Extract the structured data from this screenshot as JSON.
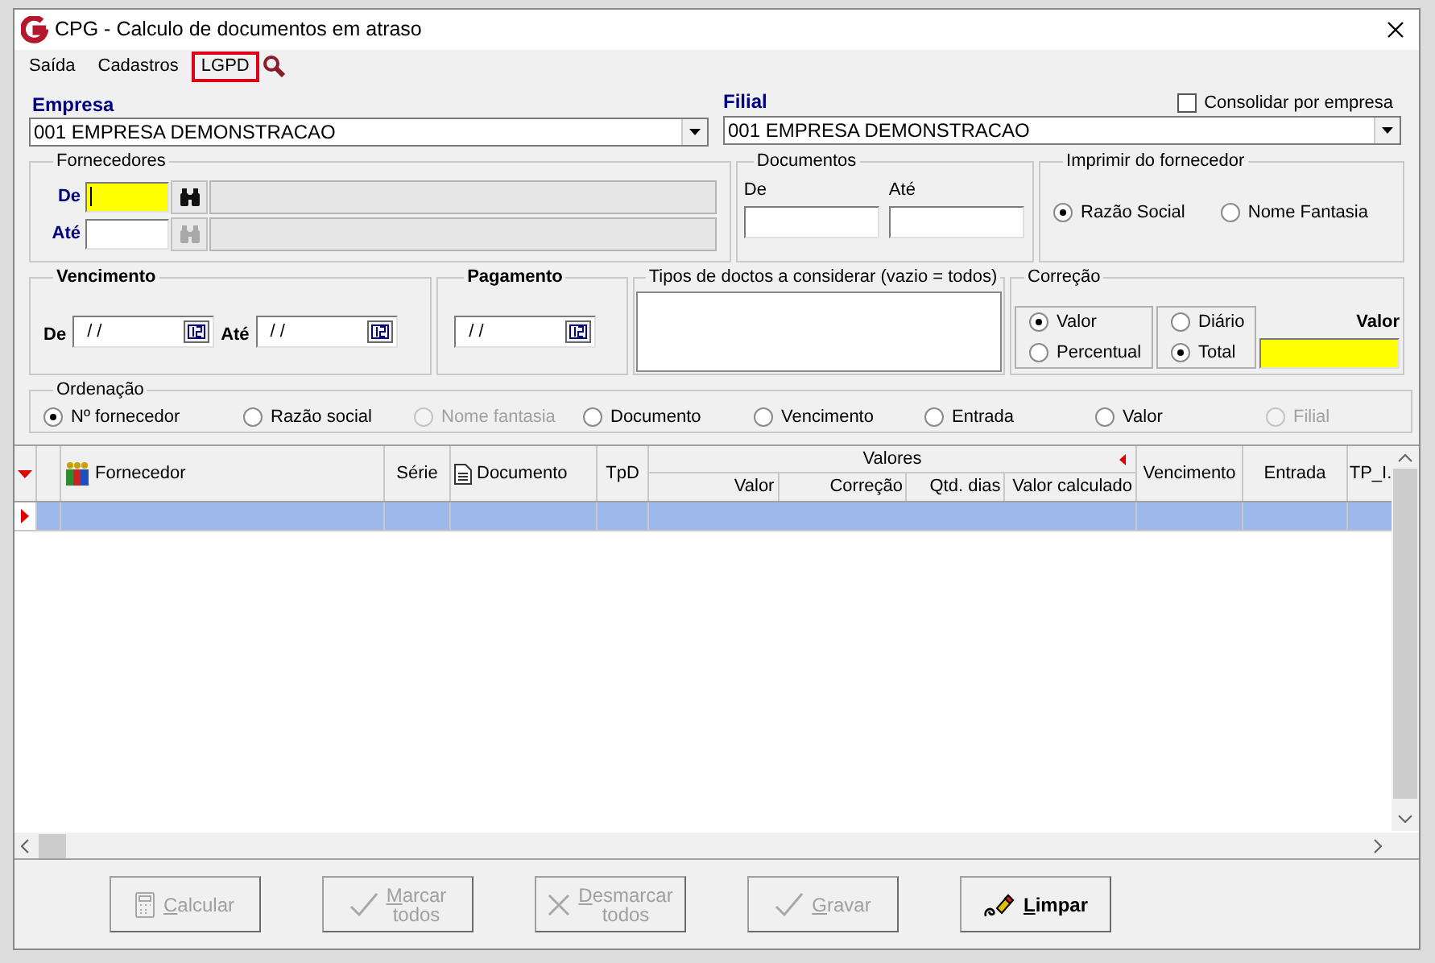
{
  "window": {
    "title": "CPG - Calculo de documentos em atraso"
  },
  "menu": [
    {
      "label": "Saída",
      "highlighted": false
    },
    {
      "label": "Cadastros",
      "highlighted": false
    },
    {
      "label": "LGPD",
      "highlighted": true
    }
  ],
  "empresa": {
    "label": "Empresa",
    "value": "001 EMPRESA DEMONSTRACAO"
  },
  "filial": {
    "label": "Filial",
    "value": "001 EMPRESA DEMONSTRACAO"
  },
  "consolidar": {
    "label": "Consolidar por empresa",
    "checked": false
  },
  "fornecedores": {
    "title": "Fornecedores",
    "rows": [
      {
        "label": "De",
        "focused": true,
        "disabled": false
      },
      {
        "label": "Até",
        "focused": false,
        "disabled": true
      }
    ]
  },
  "documentos": {
    "title": "Documentos",
    "fields": [
      {
        "label": "De"
      },
      {
        "label": "Até"
      }
    ]
  },
  "imprimir": {
    "title": "Imprimir do fornecedor",
    "options": [
      {
        "label": "Razão Social",
        "selected": true
      },
      {
        "label": "Nome Fantasia",
        "selected": false
      }
    ]
  },
  "vencimento": {
    "title": "Vencimento",
    "fields": [
      {
        "label": "De",
        "value": "/ /"
      },
      {
        "label": "Até",
        "value": "/ /"
      }
    ]
  },
  "pagamento": {
    "title": "Pagamento",
    "value": "/ /"
  },
  "tipos": {
    "title": "Tipos de doctos a considerar (vazio = todos)"
  },
  "correcao": {
    "title": "Correção",
    "tipo": [
      {
        "label": "Valor",
        "selected": true
      },
      {
        "label": "Percentual",
        "selected": false
      }
    ],
    "periodo": [
      {
        "label": "Diário",
        "selected": false
      },
      {
        "label": "Total",
        "selected": true
      }
    ],
    "valor_label": "Valor"
  },
  "ordenacao": {
    "title": "Ordenação",
    "options": [
      {
        "label": "Nº fornecedor",
        "selected": true,
        "disabled": false
      },
      {
        "label": "Razão social",
        "selected": false,
        "disabled": false
      },
      {
        "label": "Nome fantasia",
        "selected": false,
        "disabled": true
      },
      {
        "label": "Documento",
        "selected": false,
        "disabled": false
      },
      {
        "label": "Vencimento",
        "selected": false,
        "disabled": false
      },
      {
        "label": "Entrada",
        "selected": false,
        "disabled": false
      },
      {
        "label": "Valor",
        "selected": false,
        "disabled": false
      },
      {
        "label": "Filial",
        "selected": false,
        "disabled": true
      }
    ]
  },
  "grid": {
    "columns": [
      {
        "label": "Fornecedor",
        "kind": "people"
      },
      {
        "label": "Série",
        "kind": "plain"
      },
      {
        "label": "Documento",
        "kind": "doc"
      },
      {
        "label": "TpD",
        "kind": "plain"
      },
      {
        "label": "Valores",
        "kind": "group",
        "children": [
          {
            "label": "Valor"
          },
          {
            "label": "Correção"
          },
          {
            "label": "Qtd. dias"
          },
          {
            "label": "Valor calculado"
          }
        ]
      },
      {
        "label": "Vencimento",
        "kind": "plain"
      },
      {
        "label": "Entrada",
        "kind": "plain"
      },
      {
        "label": "TP_I.",
        "kind": "plain"
      }
    ],
    "rows": [
      {
        "selected": true
      }
    ]
  },
  "buttons": [
    {
      "lines": [
        "Calcular"
      ],
      "kind": "calculator",
      "disabled": true
    },
    {
      "lines": [
        "Marcar",
        "todos"
      ],
      "kind": "check",
      "disabled": true
    },
    {
      "lines": [
        "Desmarcar",
        "todos"
      ],
      "kind": "cross",
      "disabled": true
    },
    {
      "lines": [
        "Gravar"
      ],
      "kind": "check",
      "disabled": true
    },
    {
      "lines": [
        "Limpar"
      ],
      "kind": "eraser",
      "disabled": false
    }
  ]
}
